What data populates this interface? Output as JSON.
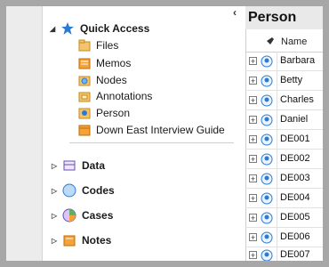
{
  "navigation": {
    "collapse_glyph": "‹",
    "quick_access": {
      "label": "Quick Access",
      "expanded": true,
      "items": [
        {
          "label": "Files",
          "icon": "files-icon"
        },
        {
          "label": "Memos",
          "icon": "memos-icon"
        },
        {
          "label": "Nodes",
          "icon": "nodes-icon"
        },
        {
          "label": "Annotations",
          "icon": "annotations-icon"
        },
        {
          "label": "Person",
          "icon": "person-icon"
        },
        {
          "label": "Down East Interview Guide",
          "icon": "notebook-icon"
        }
      ]
    },
    "sections": [
      {
        "label": "Data",
        "icon": "data-icon"
      },
      {
        "label": "Codes",
        "icon": "codes-icon"
      },
      {
        "label": "Cases",
        "icon": "cases-icon"
      },
      {
        "label": "Notes",
        "icon": "notes-icon"
      }
    ]
  },
  "list_pane": {
    "title": "Person",
    "column_name": "Name",
    "rows": [
      "Barbara",
      "Betty",
      "Charles",
      "Daniel",
      "DE001",
      "DE002",
      "DE003",
      "DE004",
      "DE005",
      "DE006",
      "DE007"
    ]
  },
  "colors": {
    "frame": "#a7a7a7",
    "title_bar": "#e9e9e9",
    "accent_blue": "#2b7bd3"
  }
}
